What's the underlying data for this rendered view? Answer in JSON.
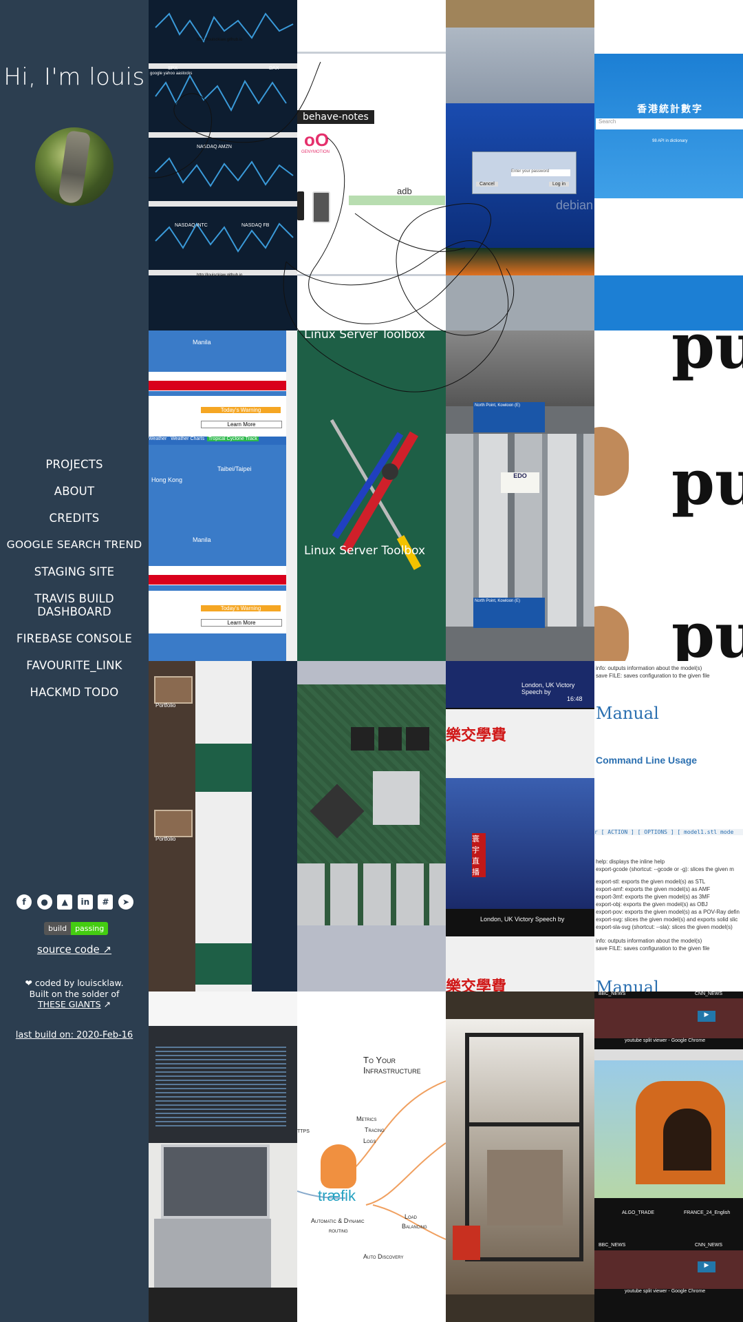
{
  "sidebar": {
    "greeting": "Hi, I'm louis",
    "nav": [
      "PROJECTS",
      "ABOUT",
      "CREDITS",
      "GOOGLE SEARCH TREND",
      "STAGING SITE",
      "TRAVIS BUILD DASHBOARD",
      "FIREBASE CONSOLE",
      "FAVOURITE_LINK",
      "HACKMD TODO"
    ],
    "social_icons": [
      "facebook-icon",
      "github-icon",
      "gitlab-icon",
      "linkedin-icon",
      "slack-icon",
      "telegram-icon"
    ],
    "badge": {
      "label": "build",
      "status": "passing"
    },
    "source_code": "source code",
    "credits_line1": "❤ coded by louiscklaw.",
    "credits_line2": "Built on the solder of",
    "giants": "THESE GIANTS",
    "last_build": "last build on: 2020-Feb-16"
  },
  "tiles": {
    "stocks": {
      "url": "http://louisckiaw.github.io",
      "labels": [
        "SPX",
        "DAX",
        "NASDAQ AMZN",
        "NASDAQ INTC",
        "NASDAQ FB"
      ],
      "sub": "google yahoo aastocks"
    },
    "adb": {
      "tag": "behave-notes",
      "label": "adb",
      "brand": "GENYMOTION"
    },
    "debian": {
      "password": "Enter your password",
      "cancel": "Cancel",
      "login": "Log in",
      "brand": "debian"
    },
    "hkstat": {
      "title": "香港統計數字",
      "search": "Search",
      "subtitle": "98 API in dictionary"
    },
    "weather": {
      "city1": "Manila",
      "city2": "Hong Kong",
      "city3": "Taibei/Taipei",
      "warning": "Today's Warning",
      "learn": "Learn More",
      "tabs": [
        "Weather",
        "Weather Charts",
        "Tropical Cyclone Track"
      ]
    },
    "toolbox": {
      "title": "Linux Server Toolbox"
    },
    "traffic": {
      "sign": "North Point, Kowloon (E)",
      "bus": "EDO"
    },
    "pug": {
      "text": "pu"
    },
    "portfolio": {
      "label": "Portfolio"
    },
    "news": {
      "ticker": "London, UK Victory Speech by",
      "time": "16:48",
      "channel": "寰宇直播",
      "headline": "樂交學費"
    },
    "manual": {
      "title": "Manual",
      "heading": "Command Line Usage",
      "lines": [
        "info: outputs information about the model(s)",
        "save FILE: saves configuration to the given file",
        "help: displays the inline help",
        "export-gcode (shortcut: --gcode or -g): slices the given m",
        "export-stl: exports the given model(s) as STL",
        "export-amf: exports the given model(s) as AMF",
        "export-3mf: exports the given model(s) as 3MF",
        "export-obj: exports the given model(s) as OBJ",
        "export-pov: exports the given model(s) as a POV-Ray defin",
        "export-svg: slices the given model(s) and exports solid slic",
        "export-sla-svg (shortcut: --sla): slices the given model(s)",
        "info: outputs information about the model(s)",
        "save FILE: saves configuration to the given file"
      ],
      "syntax": "r [ ACTION ] [ OPTIONS ] [ model1.stl mode"
    },
    "traefik": {
      "title": "To Your Infrastructure",
      "metrics": "Metrics",
      "tracing": "Tracing",
      "logs": "Logs",
      "logo": "træfik",
      "dynamic": "Automatic & Dynamic",
      "routing": "routing",
      "lb": "Load",
      "lb2": "Balancing",
      "auto": "Auto Discovery",
      "https": "TTPS"
    },
    "youtube": {
      "titles": [
        "BBC_NEWS",
        "CNN_NEWS",
        "ALGO_TRADE",
        "FRANCE_24_English"
      ],
      "window": "youtube split viewer - Google Chrome"
    }
  }
}
